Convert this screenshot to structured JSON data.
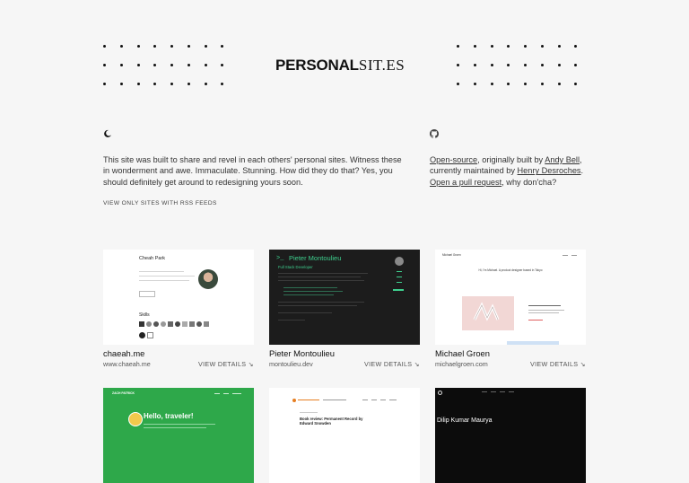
{
  "logo": {
    "bold": "PERSONAL",
    "light": "SIT.ES"
  },
  "intro": {
    "text": "This site was built to share and revel in each others' personal sites. Witness these in wonderment and awe. Immaculate. Stunning. How did they do that? Yes, you should definitely get around to redesigning yours soon."
  },
  "about": {
    "open_source": "Open-source",
    "t1": ", originally built by ",
    "andy": "Andy Bell",
    "t2": ", currently maintained by ",
    "henry": "Henry Desroches",
    "t3": ". ",
    "pull": "Open a pull request",
    "t4": ", why don'cha?"
  },
  "rss_link": "VIEW ONLY SITES WITH RSS FEEDS",
  "details_label": "VIEW DETAILS ↘",
  "cards": [
    {
      "name": "chaeah.me",
      "url": "www.chaeah.me"
    },
    {
      "name": "Pieter Montoulieu",
      "url": "montoulieu.dev"
    },
    {
      "name": "Michael Groen",
      "url": "michaelgroen.com"
    }
  ],
  "thumbs": {
    "t1": {
      "heading": "Cheah Park",
      "skills": "Skills"
    },
    "t2": {
      "title": "Pieter Montoulieu",
      "subtitle": "Full Stack Developer"
    },
    "t3": {
      "brand": "Michael Groen",
      "tagline": "Hi, I'm Michael. A product designer based in Tokyo"
    },
    "b1": {
      "brand": "ZACH PATRICK",
      "greeting": "Hello, traveler!"
    },
    "b2": {
      "title": "Book review: Permanent Record by Edward Snowden"
    },
    "b3": {
      "name": "Dilip Kumar Maurya"
    }
  },
  "colors": {
    "background": "#f6f6f6",
    "text": "#222222",
    "terminal_green": "#3ecf8e",
    "green_card": "#2ea84a"
  }
}
